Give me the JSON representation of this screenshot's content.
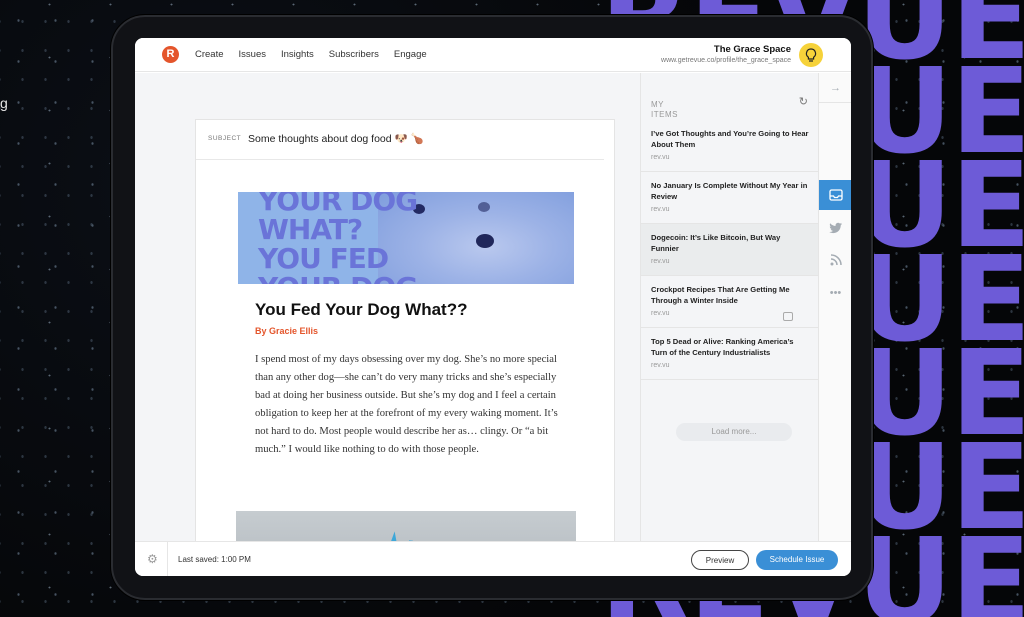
{
  "background": {
    "big_letters": [
      "REVUE",
      "REVUE",
      "REVUE",
      "REVUE",
      "REVUE",
      "REVUE",
      "REVUE"
    ],
    "edge_fragment": "g",
    "accent_color": "#6d5bd7"
  },
  "header": {
    "logo_letter": "R",
    "nav": [
      "Create",
      "Issues",
      "Insights",
      "Subscribers",
      "Engage"
    ],
    "profile_name": "The Grace Space",
    "profile_url": "www.getrevue.co/profile/the_grace_space",
    "bulb_icon": "lightbulb-icon"
  },
  "editor": {
    "subject_label": "SUBJECT",
    "subject_value": "Some thoughts about dog food 🐶 🍗",
    "hero_text": [
      "YOUR DOG",
      "WHAT?",
      "YOU FED",
      "YOUR DOG"
    ],
    "article_title": "You Fed Your Dog What??",
    "byline": "By Gracie Ellis",
    "body": "I spend most of my days obsessing over my dog. She’s no more special than any other dog—she can’t do very many tricks and she’s especially bad at doing her business outside. But she’s my dog and I feel a certain obligation to keep her at the forefront of my every waking moment. It’s not hard to do. Most people would describe her as… clingy. Or “a bit much.” I would like nothing to do with those people."
  },
  "sidebar": {
    "heading": "MY ITEMS",
    "items": [
      {
        "title": "I’ve Got Thoughts and You’re Going to Hear About Them",
        "source": "rev.vu"
      },
      {
        "title": "No January Is Complete Without My Year in Review",
        "source": "rev.vu"
      },
      {
        "title": "Dogecoin: It’s Like Bitcoin, But Way Funnier",
        "source": "rev.vu"
      },
      {
        "title": "Crockpot Recipes That Are Getting Me Through a Winter Inside",
        "source": "rev.vu"
      },
      {
        "title": "Top 5 Dead or Alive: Ranking America’s Turn of the Century Industrialists",
        "source": "rev.vu"
      }
    ],
    "load_more": "Load more..."
  },
  "footer": {
    "last_saved": "Last saved: 1:00 PM",
    "preview_label": "Preview",
    "schedule_label": "Schedule Issue"
  }
}
